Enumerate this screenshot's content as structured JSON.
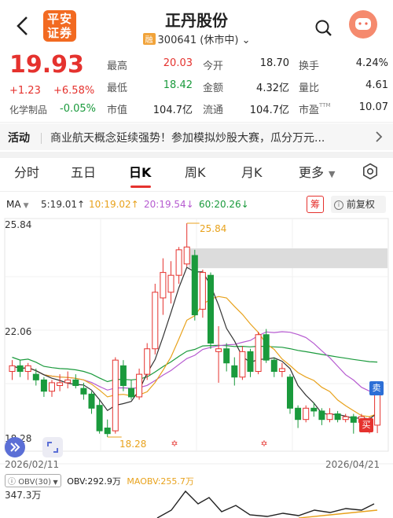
{
  "header": {
    "broker_logo": "平安\n证券",
    "stock_name": "正丹股份",
    "badge": "融",
    "code_status": "300641 (休市中)",
    "icons": [
      "back-icon",
      "search-icon",
      "assistant-avatar-icon"
    ]
  },
  "quote": {
    "price": "19.93",
    "change": "+1.23",
    "change_pct": "+6.58%",
    "sector": "化学制品",
    "sector_pct": "-0.05%",
    "stats": [
      {
        "label": "最高",
        "value": "20.03",
        "color": "red"
      },
      {
        "label": "今开",
        "value": "18.70",
        "color": "dark"
      },
      {
        "label": "换手",
        "value": "4.24%",
        "color": "dark"
      },
      {
        "label": "最低",
        "value": "18.42",
        "color": "green"
      },
      {
        "label": "金额",
        "value": "4.32亿",
        "color": "dark"
      },
      {
        "label": "量比",
        "value": "4.61",
        "color": "dark"
      },
      {
        "label": "市值",
        "value": "104.7亿",
        "color": "dark"
      },
      {
        "label": "流通",
        "value": "104.7亿",
        "color": "dark"
      },
      {
        "label": "市盈",
        "value": "10.07",
        "color": "dark",
        "sup": "TTM"
      }
    ]
  },
  "activity": {
    "tag": "活动",
    "text": "商业航天概念延续强势！参加模拟炒股大赛，瓜分万元..."
  },
  "tabs": {
    "items": [
      "分时",
      "五日",
      "日K",
      "周K",
      "月K",
      "更多"
    ],
    "active": "日K"
  },
  "indicators": {
    "label": "MA",
    "ma5": "5:19.01↑",
    "ma10": "10:19.02↑",
    "ma20": "20:19.54↓",
    "ma60": "60:20.26↓",
    "chou": "筹",
    "restore": "前复权",
    "colors": {
      "ma5": "#333333",
      "ma10": "#e8a21c",
      "ma20": "#b65bd0",
      "ma60": "#e05a9b"
    }
  },
  "kline": {
    "y_top": "25.84",
    "y_mid": "22.06",
    "y_bottom": "18.28",
    "max_label": "25.84",
    "min_label": "18.28",
    "date_start": "2026/02/11",
    "date_end": "2026/04/21",
    "sell_label": "卖",
    "buy_label": "买",
    "candles": [
      {
        "o": 20.6,
        "c": 20.8,
        "h": 21.0,
        "l": 20.3
      },
      {
        "o": 20.8,
        "c": 20.6,
        "h": 21.0,
        "l": 20.4
      },
      {
        "o": 20.6,
        "c": 20.8,
        "h": 20.9,
        "l": 20.3
      },
      {
        "o": 20.5,
        "c": 20.3,
        "h": 20.7,
        "l": 20.1
      },
      {
        "o": 20.3,
        "c": 19.9,
        "h": 20.4,
        "l": 19.7
      },
      {
        "o": 19.9,
        "c": 20.2,
        "h": 20.3,
        "l": 19.7
      },
      {
        "o": 20.1,
        "c": 20.2,
        "h": 20.5,
        "l": 19.9
      },
      {
        "o": 20.2,
        "c": 20.3,
        "h": 20.6,
        "l": 20.0
      },
      {
        "o": 20.3,
        "c": 20.1,
        "h": 20.5,
        "l": 20.0
      },
      {
        "o": 20.0,
        "c": 19.8,
        "h": 20.2,
        "l": 19.6
      },
      {
        "o": 19.8,
        "c": 19.3,
        "h": 19.9,
        "l": 19.1
      },
      {
        "o": 19.4,
        "c": 18.5,
        "h": 19.6,
        "l": 18.4
      },
      {
        "o": 18.6,
        "c": 18.4,
        "h": 18.9,
        "l": 18.28
      },
      {
        "o": 18.5,
        "c": 21.0,
        "h": 21.1,
        "l": 18.4
      },
      {
        "o": 20.8,
        "c": 20.1,
        "h": 21.0,
        "l": 19.9
      },
      {
        "o": 20.0,
        "c": 19.7,
        "h": 20.3,
        "l": 19.6
      },
      {
        "o": 19.7,
        "c": 20.5,
        "h": 20.7,
        "l": 19.6
      },
      {
        "o": 20.5,
        "c": 21.4,
        "h": 21.6,
        "l": 20.3
      },
      {
        "o": 21.4,
        "c": 23.4,
        "h": 23.7,
        "l": 21.2
      },
      {
        "o": 23.2,
        "c": 24.1,
        "h": 24.6,
        "l": 22.6
      },
      {
        "o": 23.4,
        "c": 24.0,
        "h": 24.5,
        "l": 23.0
      },
      {
        "o": 24.0,
        "c": 24.9,
        "h": 25.0,
        "l": 23.7
      },
      {
        "o": 24.4,
        "c": 25.0,
        "h": 25.84,
        "l": 24.3
      },
      {
        "o": 24.7,
        "c": 22.6,
        "h": 24.9,
        "l": 22.4
      },
      {
        "o": 22.8,
        "c": 24.1,
        "h": 24.2,
        "l": 22.5
      },
      {
        "o": 24.0,
        "c": 21.6,
        "h": 24.1,
        "l": 21.4
      },
      {
        "o": 21.3,
        "c": 21.4,
        "h": 22.2,
        "l": 20.2
      },
      {
        "o": 21.4,
        "c": 20.9,
        "h": 21.6,
        "l": 20.6
      },
      {
        "o": 20.8,
        "c": 20.4,
        "h": 21.1,
        "l": 20.1
      },
      {
        "o": 20.4,
        "c": 21.3,
        "h": 21.5,
        "l": 20.3
      },
      {
        "o": 21.3,
        "c": 20.6,
        "h": 21.4,
        "l": 20.4
      },
      {
        "o": 20.6,
        "c": 21.9,
        "h": 22.0,
        "l": 20.5
      },
      {
        "o": 21.9,
        "c": 21.0,
        "h": 22.1,
        "l": 20.9
      },
      {
        "o": 21.0,
        "c": 20.6,
        "h": 21.1,
        "l": 20.4
      },
      {
        "o": 20.6,
        "c": 20.7,
        "h": 20.9,
        "l": 20.4
      },
      {
        "o": 20.4,
        "c": 19.3,
        "h": 20.5,
        "l": 19.1
      },
      {
        "o": 19.3,
        "c": 18.9,
        "h": 19.4,
        "l": 18.6
      },
      {
        "o": 18.9,
        "c": 19.3,
        "h": 19.4,
        "l": 18.8
      },
      {
        "o": 19.3,
        "c": 19.2,
        "h": 19.5,
        "l": 19.0
      },
      {
        "o": 19.2,
        "c": 18.9,
        "h": 19.3,
        "l": 18.7
      },
      {
        "o": 18.9,
        "c": 19.1,
        "h": 19.3,
        "l": 18.8
      },
      {
        "o": 19.1,
        "c": 18.9,
        "h": 19.2,
        "l": 18.8
      },
      {
        "o": 18.9,
        "c": 19.0,
        "h": 19.1,
        "l": 18.8
      },
      {
        "o": 19.0,
        "c": 18.8,
        "h": 19.1,
        "l": 18.4
      },
      {
        "o": 18.8,
        "c": 19.0,
        "h": 19.1,
        "l": 18.7
      },
      {
        "o": 18.7,
        "c": 18.9,
        "h": 19.0,
        "l": 18.4
      },
      {
        "o": 18.7,
        "c": 19.93,
        "h": 20.03,
        "l": 18.42
      }
    ]
  },
  "obv": {
    "badge": "OBV(30)",
    "value": "OBV:292.9万",
    "ma": "MAOBV:255.7万",
    "axis_top": "347.3万"
  }
}
